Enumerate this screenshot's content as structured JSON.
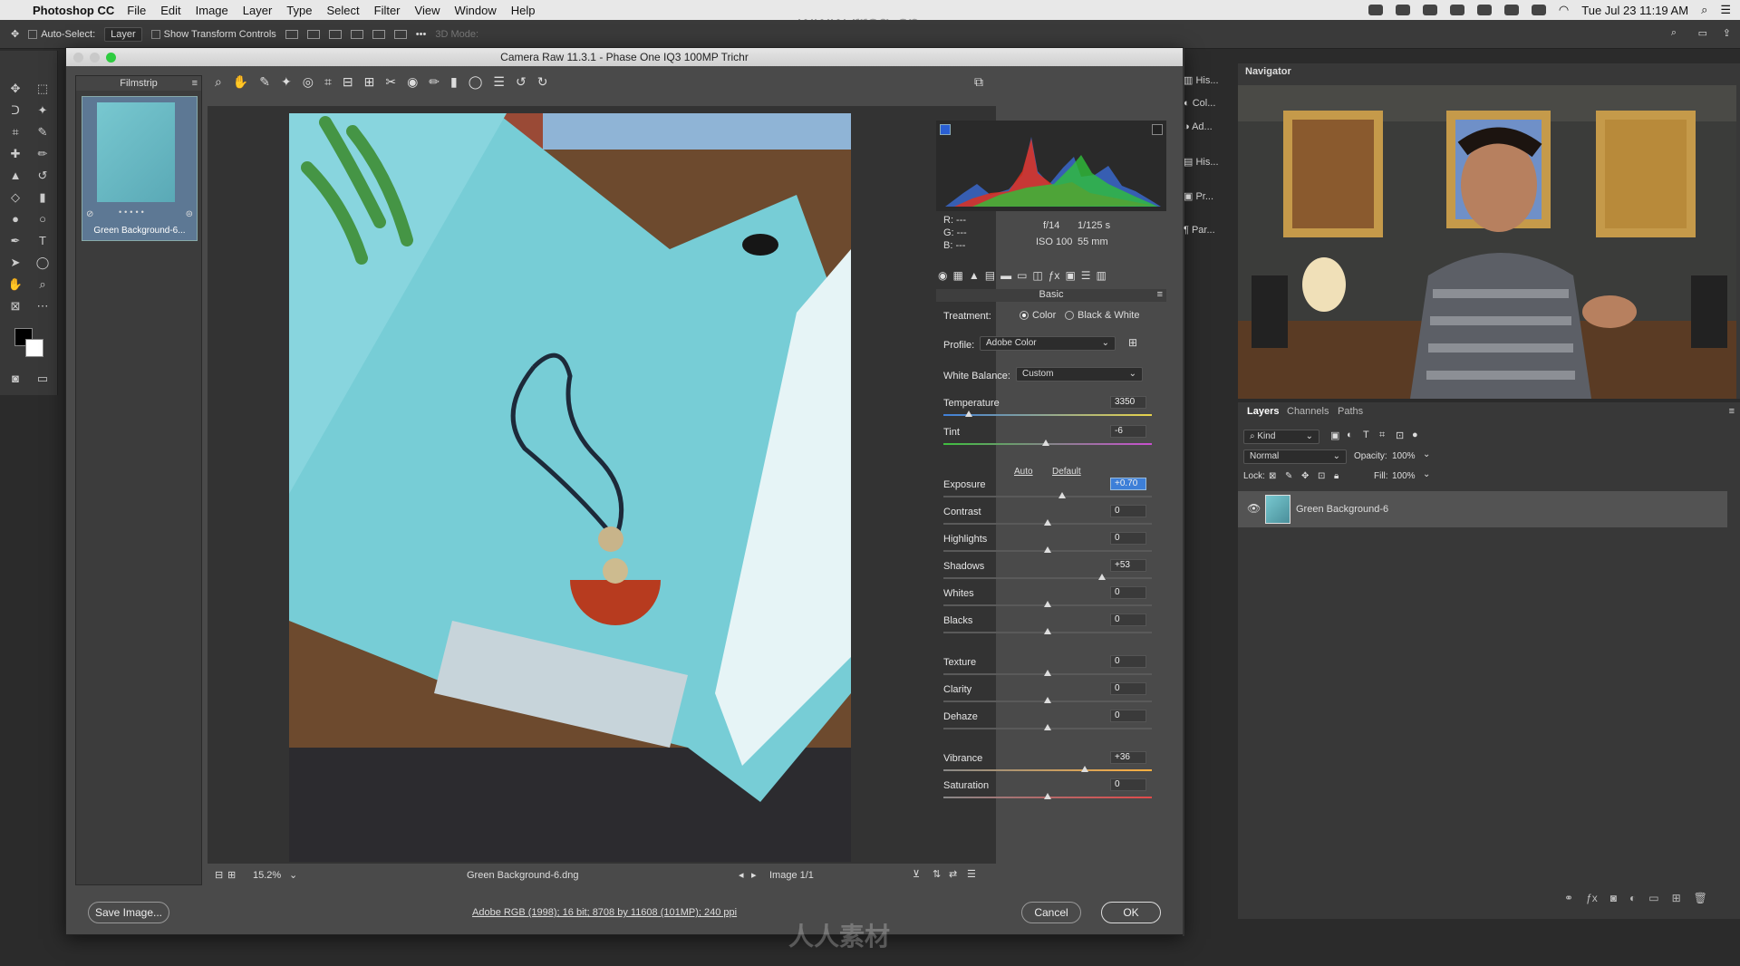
{
  "menubar": {
    "app_name": "Photoshop CC",
    "items": [
      "File",
      "Edit",
      "Image",
      "Layer",
      "Type",
      "Select",
      "Filter",
      "View",
      "Window",
      "Help"
    ],
    "clock": "Tue Jul 23  11:19 AM"
  },
  "options_bar": {
    "auto_select_label": "Auto-Select:",
    "auto_select_value": "Layer",
    "transform_label": "Show Transform Controls",
    "mode3d_label": "3D Mode:"
  },
  "watermark": {
    "top": "www.rrcg.cn",
    "bottom": "人人素材"
  },
  "camera_raw": {
    "title": "Camera Raw 11.3.1  -  Phase One IQ3 100MP Trichr",
    "filmstrip": {
      "label": "Filmstrip",
      "thumb_name": "Green Background-6..."
    },
    "status": {
      "zoom": "15.2%",
      "filename": "Green Background-6.dng",
      "image_count": "Image 1/1"
    },
    "exif": {
      "r": "R:   ---",
      "g": "G:   ---",
      "b": "B:   ---",
      "aperture": "f/14",
      "shutter": "1/125 s",
      "iso": "ISO 100",
      "focal": "55 mm"
    },
    "panel_title": "Basic",
    "treatment_label": "Treatment:",
    "treatment_color": "Color",
    "treatment_bw": "Black & White",
    "profile_label": "Profile:",
    "profile_value": "Adobe Color",
    "wb_label": "White Balance:",
    "wb_value": "Custom",
    "auto_label": "Auto",
    "default_label": "Default",
    "sliders": [
      {
        "label": "Temperature",
        "value": "3350",
        "pos": 0.12
      },
      {
        "label": "Tint",
        "value": "-6",
        "pos": 0.49
      },
      {
        "label": "Exposure",
        "value": "+0.70",
        "pos": 0.57
      },
      {
        "label": "Contrast",
        "value": "0",
        "pos": 0.5
      },
      {
        "label": "Highlights",
        "value": "0",
        "pos": 0.5
      },
      {
        "label": "Shadows",
        "value": "+53",
        "pos": 0.76
      },
      {
        "label": "Whites",
        "value": "0",
        "pos": 0.5
      },
      {
        "label": "Blacks",
        "value": "0",
        "pos": 0.5
      },
      {
        "label": "Texture",
        "value": "0",
        "pos": 0.5
      },
      {
        "label": "Clarity",
        "value": "0",
        "pos": 0.5
      },
      {
        "label": "Dehaze",
        "value": "0",
        "pos": 0.5
      },
      {
        "label": "Vibrance",
        "value": "+36",
        "pos": 0.68
      },
      {
        "label": "Saturation",
        "value": "0",
        "pos": 0.5
      }
    ],
    "side_buttons": [
      "His...",
      "Col...",
      "Ad...",
      "His...",
      "Pr...",
      "Par..."
    ],
    "save_button": "Save Image...",
    "info_link": "Adobe RGB (1998); 16 bit; 8708 by 11608 (101MP); 240 ppi",
    "cancel_button": "Cancel",
    "ok_button": "OK"
  },
  "navigator": {
    "title": "Navigator"
  },
  "layers": {
    "tabs": [
      "Layers",
      "Channels",
      "Paths"
    ],
    "kind_label": "Kind",
    "blend_mode": "Normal",
    "opacity_label": "Opacity:",
    "opacity_value": "100%",
    "lock_label": "Lock:",
    "fill_label": "Fill:",
    "fill_value": "100%",
    "layer_name": "Green Background-6"
  },
  "colors": {
    "accent_blue": "#3d7fd8",
    "photo_cyan": "#7fd0d8",
    "dialog_bg": "#4a4a4a"
  }
}
